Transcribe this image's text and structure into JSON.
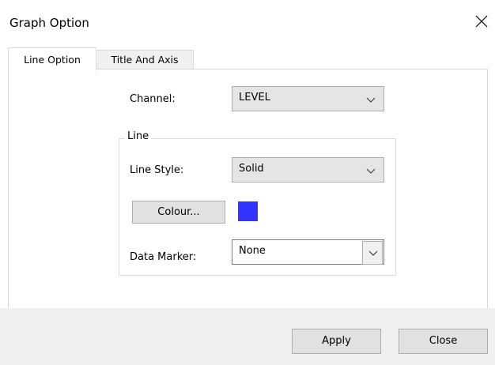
{
  "window": {
    "title": "Graph Option",
    "close_icon": "close-icon"
  },
  "tabs": [
    {
      "label": "Line Option",
      "active": true
    },
    {
      "label": "Title And Axis",
      "active": false
    }
  ],
  "form": {
    "channel_label": "Channel:",
    "channel_value": "LEVEL",
    "group_label": "Line",
    "line_style_label": "Line Style:",
    "line_style_value": "Solid",
    "colour_button_label": "Colour...",
    "colour_value": "#3333ff",
    "data_marker_label": "Data Marker:",
    "data_marker_value": "None"
  },
  "footer": {
    "apply_label": "Apply",
    "close_label": "Close"
  },
  "colors": {
    "swatch": "#3333ff",
    "footer_bg": "#f0f0f0",
    "combo_bg": "#e5e5e5"
  }
}
